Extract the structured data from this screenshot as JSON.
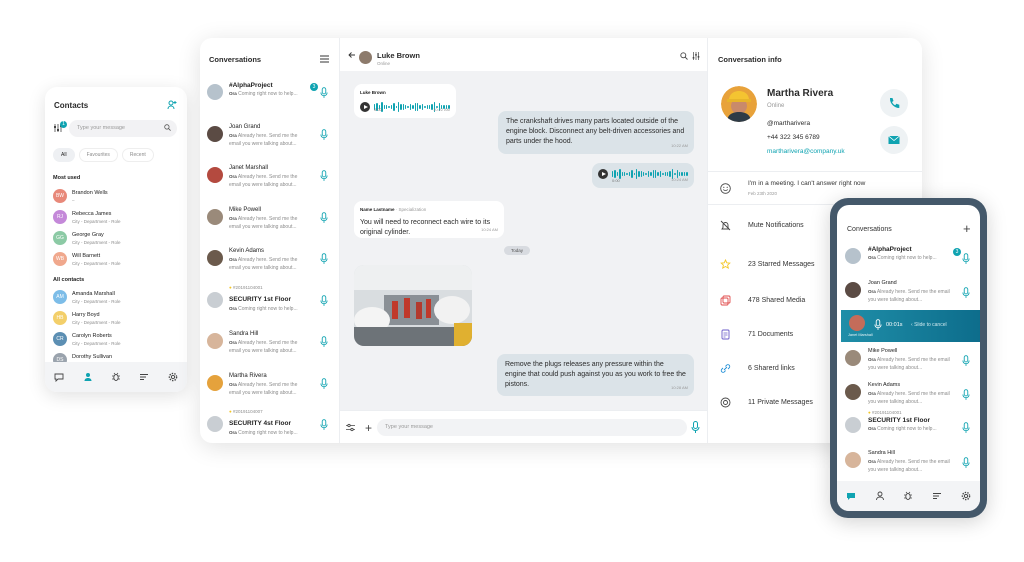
{
  "colors": {
    "accent": "#0fa3b1",
    "frame": "#44586a"
  },
  "contacts_phone": {
    "title": "Contacts",
    "badge": "1",
    "search_placeholder": "Type your message",
    "tabs": [
      "All",
      "Favourites",
      "Recent"
    ],
    "most_used_label": "Most used",
    "most_used": [
      {
        "initials": "BW",
        "name": "Brandon Wells",
        "sub": "–",
        "color": "#e8897a"
      },
      {
        "initials": "RJ",
        "name": "Rebecca James",
        "sub": "City - Department - Role",
        "color": "#c489d9"
      },
      {
        "initials": "GG",
        "name": "George Gray",
        "sub": "City - Department - Role",
        "color": "#8ccaa5"
      },
      {
        "initials": "WB",
        "name": "Will Barnett",
        "sub": "City - Department - Role",
        "color": "#f0a88d"
      }
    ],
    "all_contacts_label": "All contacts",
    "all_contacts": [
      {
        "initials": "AM",
        "name": "Amanda Marshall",
        "sub": "City - Department - Role",
        "color": "#7dbde8"
      },
      {
        "initials": "HB",
        "name": "Harry Boyd",
        "sub": "City - Department - Role",
        "color": "#f3cf6a"
      },
      {
        "initials": "CR",
        "name": "Carolyn Roberts",
        "sub": "City - Department - Role",
        "color": "#5c8fb3"
      },
      {
        "initials": "DS",
        "name": "Dorothy Sullivan",
        "sub": "",
        "color": "#9aa3ad"
      }
    ]
  },
  "conversations": {
    "title": "Conversations",
    "items": [
      {
        "name": "#AlphaProject",
        "bold": true,
        "pre": "",
        "sender": "Ora",
        "msg": "Coming right now to help...",
        "unread": "3",
        "avatar": "#b6c2cc"
      },
      {
        "name": "Joan Grand",
        "bold": false,
        "pre": "",
        "sender": "Ora",
        "msg": "Already here. Send me the email you were talking about...",
        "unread": "",
        "avatar": "#5b4b44"
      },
      {
        "name": "Janet Marshall",
        "bold": false,
        "pre": "",
        "sender": "Ora",
        "msg": "Already here. Send me the email you were talking about...",
        "unread": "",
        "avatar": "#b44a3f"
      },
      {
        "name": "Mike Powell",
        "bold": false,
        "pre": "",
        "sender": "Ora",
        "msg": "Already here. Send me the email you were talking about...",
        "unread": "",
        "avatar": "#9a8a7a"
      },
      {
        "name": "Kevin Adams",
        "bold": false,
        "pre": "",
        "sender": "Ora",
        "msg": "Already here. Send me the email you were talking about...",
        "unread": "",
        "avatar": "#6b5a4c"
      },
      {
        "name": "SECURITY 1st Floor",
        "bold": true,
        "pre": "#20191104001",
        "sender": "Ora",
        "msg": "Coming right now to help...",
        "unread": "",
        "avatar": "#c9ced3"
      },
      {
        "name": "Sandra Hill",
        "bold": false,
        "pre": "",
        "sender": "Ora",
        "msg": "Already here. Send me the email you were talking about...",
        "unread": "",
        "avatar": "#d7b59b"
      },
      {
        "name": "Martha Rivera",
        "bold": false,
        "pre": "",
        "sender": "Ora",
        "msg": "Already here. Send me the email you were talking about...",
        "unread": "",
        "avatar": "#e5a23c"
      },
      {
        "name": "SECURITY 4st Floor",
        "bold": true,
        "pre": "#20191104007",
        "sender": "Ora",
        "msg": "Coming right now to help...",
        "unread": "",
        "avatar": "#c9ced3"
      }
    ]
  },
  "chat": {
    "contact_name": "Luke Brown",
    "contact_status": "Online",
    "audio_sender": "Luke Brown",
    "audio_in_duration": "0:00",
    "audio_in_time": "10:22 AM",
    "msg1": "The crankshaft drives many parts located outside of the engine block. Disconnect any belt-driven accessories and parts under the hood.",
    "msg1_time": "10:22 AM",
    "audio_out_duration": "0:00",
    "audio_out_time": "10:24 AM",
    "msg2_sender": "Name Lastname",
    "msg2_role": "· Specialization",
    "msg2": "You will need to reconnect each wire to its original cylinder.",
    "msg2_time": "10:24 AM",
    "day_label": "Today",
    "msg3": "Remove the plugs releases any pressure within the engine that could push against you as you work to free the pistons.",
    "msg3_time": "10:28 AM",
    "composer_placeholder": "Type your message"
  },
  "info": {
    "title": "Conversation info",
    "name": "Martha Rivera",
    "status": "Online",
    "handle": "@martharivera",
    "phone": "+44 322 345 6789",
    "email": "martharivera@company.uk",
    "status_message": "I'm in a meeting. I can't answer right now",
    "status_date": "Feb 23th 2020",
    "rows": [
      {
        "icon": "mute-icon",
        "label": "Mute Notifications"
      },
      {
        "icon": "star-icon",
        "label": "23 Starred Messages"
      },
      {
        "icon": "media-icon",
        "label": "478 Shared Media"
      },
      {
        "icon": "document-icon",
        "label": "71 Documents"
      },
      {
        "icon": "link-icon",
        "label": "6 Sharerd links"
      },
      {
        "icon": "private-icon",
        "label": "11 Private Messages"
      }
    ]
  },
  "mobile": {
    "title": "Conversations",
    "items": [
      {
        "name": "#AlphaProject",
        "bold": true,
        "pre": "",
        "sender": "Ora",
        "msg": "Coming right now to help...",
        "unread": "3",
        "avatar": "#b6c2cc"
      },
      {
        "name": "Joan Grand",
        "bold": false,
        "pre": "",
        "sender": "Ora",
        "msg": "Already here. Send me the email you were talking about...",
        "unread": "",
        "avatar": "#5b4b44"
      },
      {
        "name": "Mike Powell",
        "bold": false,
        "pre": "",
        "sender": "Ora",
        "msg": "Already here. Send me the email you were talking about...",
        "unread": "",
        "avatar": "#9a8a7a"
      },
      {
        "name": "Kevin Adams",
        "bold": false,
        "pre": "",
        "sender": "Ora",
        "msg": "Already here. Send me the email you were talking about...",
        "unread": "",
        "avatar": "#6b5a4c"
      },
      {
        "name": "SECURITY 1st Floor",
        "bold": true,
        "pre": "#20191104001",
        "sender": "Ora",
        "msg": "Coming right now to help...",
        "unread": "",
        "avatar": "#c9ced3"
      },
      {
        "name": "Sandra Hill",
        "bold": false,
        "pre": "",
        "sender": "Ora",
        "msg": "Already here. Send me the email you were talking about...",
        "unread": "",
        "avatar": "#d7b59b"
      }
    ],
    "recording": {
      "time": "00:01s",
      "slide_text": "Slide to cancel",
      "user": "Janet Marshall"
    }
  }
}
